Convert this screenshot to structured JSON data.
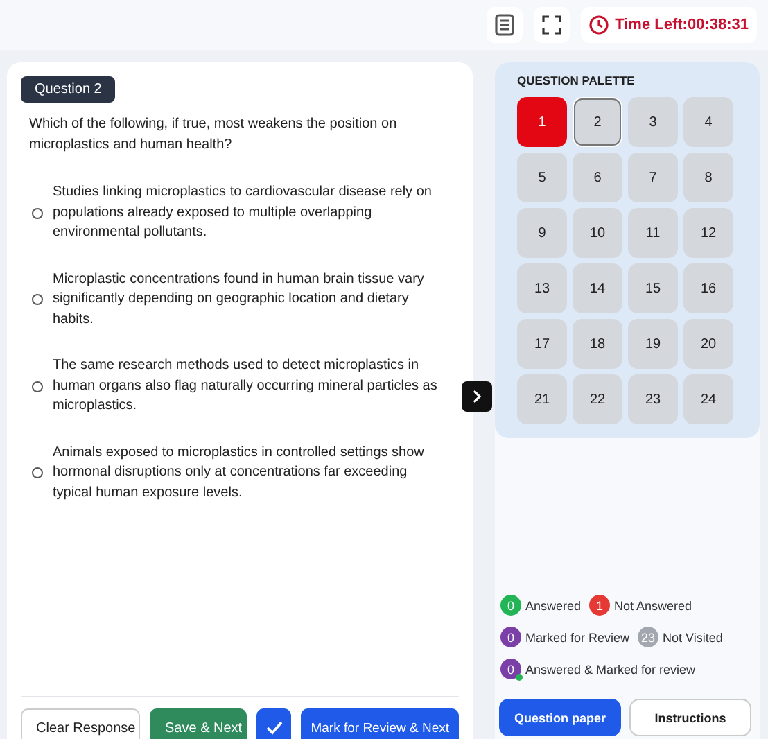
{
  "timer": {
    "label": "Time Left:00:38:31"
  },
  "question": {
    "badge": "Question 2",
    "text": "Which of the following, if true, most weakens the position on microplastics and human health?",
    "options": [
      {
        "text": "Studies linking microplastics to cardiovascular disease rely on populations already exposed to multiple overlapping environmental pollutants.",
        "selected": false
      },
      {
        "text": "Microplastic concentrations found in human brain tissue vary significantly depending on geographic location and dietary habits.",
        "selected": false
      },
      {
        "text": "The same research methods used to detect microplastics in human organs also flag naturally occurring mineral particles as microplastics.",
        "selected": false
      },
      {
        "text": "Animals exposed to microplastics in controlled settings show hormonal disruptions only at concentrations far exceeding typical human exposure levels.",
        "selected": false
      }
    ]
  },
  "actions": [
    {
      "label": "Clear Response",
      "kind": "outline"
    },
    {
      "label": "Save & Next",
      "kind": "green"
    },
    {
      "kind": "check"
    },
    {
      "label": "Mark for Review & Next",
      "kind": "blue"
    }
  ],
  "palette": {
    "title": "QUESTION PALETTE",
    "questions": [
      {
        "n": "1",
        "color": "#e30613",
        "selected": false
      },
      {
        "n": "2",
        "color": "#d4d8dd",
        "selected": true
      },
      {
        "n": "3",
        "color": "#d4d8dd",
        "selected": false
      },
      {
        "n": "4",
        "color": "#d4d8dd",
        "selected": false
      },
      {
        "n": "5",
        "color": "#d4d8dd",
        "selected": false
      },
      {
        "n": "6",
        "color": "#d4d8dd",
        "selected": false
      },
      {
        "n": "7",
        "color": "#d4d8dd",
        "selected": false
      },
      {
        "n": "8",
        "color": "#d4d8dd",
        "selected": false
      },
      {
        "n": "9",
        "color": "#d4d8dd",
        "selected": false
      },
      {
        "n": "10",
        "color": "#d4d8dd",
        "selected": false
      },
      {
        "n": "11",
        "color": "#d4d8dd",
        "selected": false
      },
      {
        "n": "12",
        "color": "#d4d8dd",
        "selected": false
      },
      {
        "n": "13",
        "color": "#d4d8dd",
        "selected": false
      },
      {
        "n": "14",
        "color": "#d4d8dd",
        "selected": false
      },
      {
        "n": "15",
        "color": "#d4d8dd",
        "selected": false
      },
      {
        "n": "16",
        "color": "#d4d8dd",
        "selected": false
      },
      {
        "n": "17",
        "color": "#d4d8dd",
        "selected": false
      },
      {
        "n": "18",
        "color": "#d4d8dd",
        "selected": false
      },
      {
        "n": "19",
        "color": "#d4d8dd",
        "selected": false
      },
      {
        "n": "20",
        "color": "#d4d8dd",
        "selected": false
      },
      {
        "n": "21",
        "color": "#d4d8dd",
        "selected": false
      },
      {
        "n": "22",
        "color": "#d4d8dd",
        "selected": false
      },
      {
        "n": "23",
        "color": "#d4d8dd",
        "selected": false
      },
      {
        "n": "24",
        "color": "#d4d8dd",
        "selected": false
      }
    ]
  },
  "legend": [
    {
      "count": "0",
      "label": "Answered",
      "color": "#22b455",
      "marked_dot": false
    },
    {
      "count": "1",
      "label": "Not Answered",
      "color": "#e53935",
      "marked_dot": false
    },
    {
      "count": "0",
      "label": "Marked for Review",
      "color": "#7b3fa8",
      "marked_dot": false
    },
    {
      "count": "23",
      "label": "Not Visited",
      "color": "#a3a8b0",
      "marked_dot": false
    },
    {
      "count": "0",
      "label": "Answered & Marked for review",
      "color": "#7b3fa8",
      "marked_dot": true
    }
  ],
  "panel_buttons": [
    {
      "label": "Question paper",
      "selected": true
    },
    {
      "label": "Instructions",
      "selected": false
    }
  ]
}
